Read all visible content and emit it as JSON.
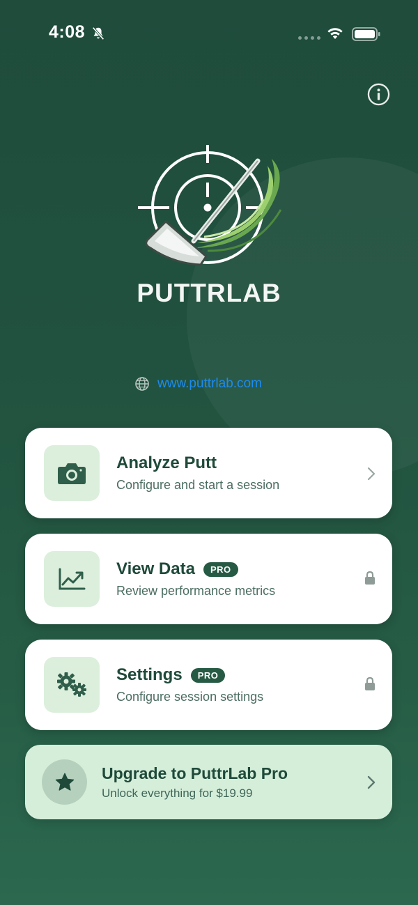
{
  "status_bar": {
    "time": "4:08"
  },
  "app": {
    "name": "PUTTRLAB",
    "website": "www.puttrlab.com"
  },
  "menu": [
    {
      "title": "Analyze Putt",
      "subtitle": "Configure and start a session",
      "icon": "camera-icon",
      "badge": "",
      "trailing": "chevron-right-icon"
    },
    {
      "title": "View Data",
      "subtitle": "Review performance metrics",
      "icon": "chart-icon",
      "badge": "PRO",
      "trailing": "lock-icon"
    },
    {
      "title": "Settings",
      "subtitle": "Configure session settings",
      "icon": "gears-icon",
      "badge": "PRO",
      "trailing": "lock-icon"
    }
  ],
  "upgrade": {
    "title": "Upgrade to PuttrLab Pro",
    "subtitle": "Unlock everything for $19.99",
    "icon": "star-icon"
  },
  "colors": {
    "background": "#21523f",
    "card": "#ffffff",
    "icon_box": "#dcefdc",
    "text_primary": "#1f4a3a",
    "link": "#1e8bf0",
    "upgrade_bg": "#d5eeda"
  }
}
